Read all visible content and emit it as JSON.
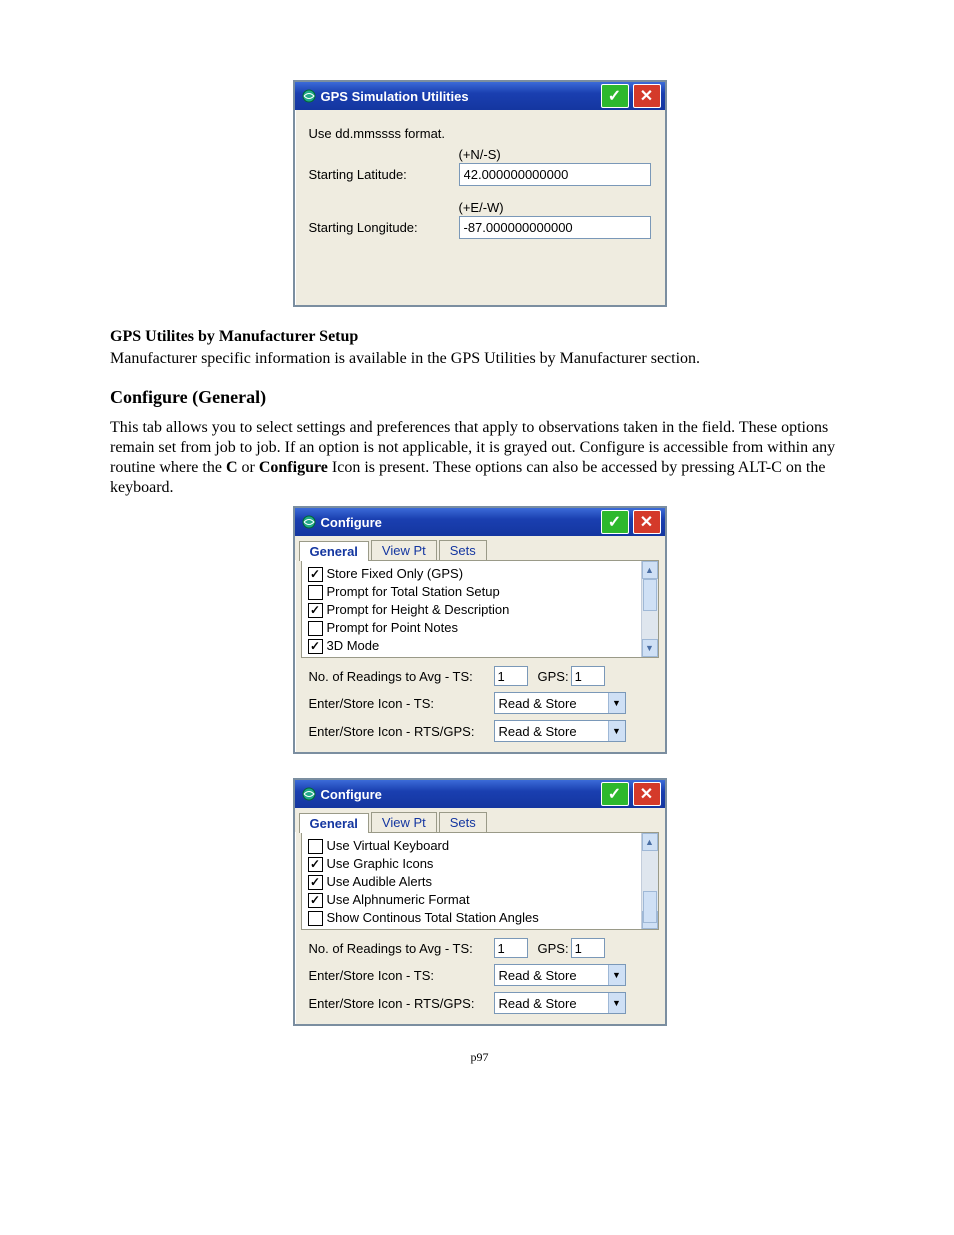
{
  "win1": {
    "title": "GPS Simulation Utilities",
    "format_hint": "Use dd.mmssss format.",
    "lat_label": "Starting Latitude:",
    "lat_hint": "(+N/-S)",
    "lat_value": "42.000000000000",
    "lon_label": "Starting Longitude:",
    "lon_hint": "(+E/-W)",
    "lon_value": "-87.000000000000"
  },
  "doc": {
    "section1_title": "GPS Utilites by Manufacturer Setup",
    "section1_body": "Manufacturer specific information is available in the GPS Utilities by Manufacturer section.",
    "section2_title": "Configure (General)",
    "section2_body_pre": "This tab allows you to select settings and preferences that apply to observations taken in the field. These options remain set from job to job. If an option is not applicable, it is grayed out. Configure is  accessible from within any routine where the ",
    "section2_body_c": "C",
    "section2_body_mid": " or ",
    "section2_body_conf": "Configure",
    "section2_body_post": " Icon is present.  These options can also be accessed by pressing ALT-C on the keyboard.",
    "page_number": "p97"
  },
  "conf": {
    "title": "Configure",
    "tabs": {
      "t1": "General",
      "t2": "View Pt",
      "t3": "Sets"
    },
    "checks_a": [
      {
        "label": "Store Fixed Only (GPS)",
        "checked": true
      },
      {
        "label": "Prompt for Total Station Setup",
        "checked": false
      },
      {
        "label": "Prompt for Height & Description",
        "checked": true
      },
      {
        "label": "Prompt for Point Notes",
        "checked": false
      },
      {
        "label": "3D Mode",
        "checked": true
      }
    ],
    "checks_b": [
      {
        "label": "Use Virtual Keyboard",
        "checked": false
      },
      {
        "label": "Use Graphic Icons",
        "checked": true
      },
      {
        "label": "Use Audible Alerts",
        "checked": true
      },
      {
        "label": "Use Alphnumeric Format",
        "checked": true
      },
      {
        "label": "Show Continous Total Station Angles",
        "checked": false
      }
    ],
    "readings_label": "No. of Readings to Avg  -  TS:",
    "readings_ts": "1",
    "readings_gps_label": "GPS:",
    "readings_gps": "1",
    "enterstore_ts_label": "Enter/Store Icon - TS:",
    "enterstore_ts_value": "Read & Store",
    "enterstore_rts_label": "Enter/Store Icon - RTS/GPS:",
    "enterstore_rts_value": "Read & Store"
  }
}
